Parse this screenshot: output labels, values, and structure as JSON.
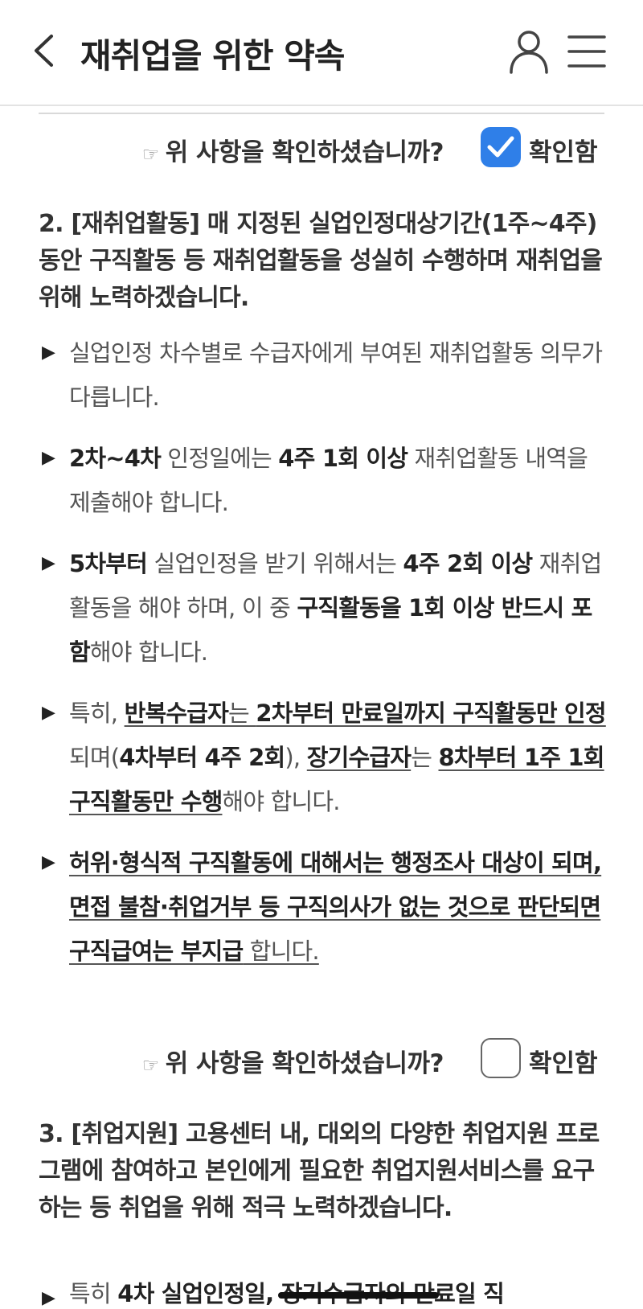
{
  "header": {
    "title": "재취업을 위한 약속",
    "back_icon": "chevron-left-icon",
    "user_icon": "user-icon",
    "menu_icon": "hamburger-menu-icon"
  },
  "confirm_1": {
    "hand_glyph": "☞",
    "question": "위 사항을 확인하셨습니까?",
    "label": "확인함",
    "checked": true
  },
  "section_2": {
    "heading": "2. [재취업활동] 매 지정된 실업인정대상기간(1주~4주) 동안 구직활동 등 재취업활동을 성실히 수행하며 재취업을 위해 노력하겠습니다.",
    "bullets": [
      {
        "p1": "실업인정 차수별로 수급자에게 부여된 재취업활동 의무가 다릅니다."
      },
      {
        "b1": "2차~4차",
        "p1": " 인정일에는 ",
        "b2": "4주 1회 이상",
        "p2": " 재취업활동 내역을 제출해야 합니다."
      },
      {
        "b1": "5차부터",
        "p1": " 실업인정을 받기 위해서는 ",
        "b2": "4주 2회 이상",
        "p2": " 재취업활동을 해야 하며, 이 중 ",
        "b3": "구직활동을 1회 이상 반드시 포함",
        "p3": "해야 합니다."
      },
      {
        "p0": "특히, ",
        "u1": "반복수급자",
        "u2": "는 ",
        "u3": "2차부터 만료일까지 구직활동만 인정",
        "p1": "되며(",
        "b1": "4차부터 4주 2회",
        "p2": "), ",
        "u4": "장기수급자",
        "p3": "는 ",
        "u5": "8차부터 1주 1회 구직활동만 수행",
        "p4": "해야 합니다."
      },
      {
        "u1": "허위·형식적 구직활동에 대해서는 행정조사 대상이 되며, 면접 불참·취업거부 등 구직의사가 없는 것으로 판단되면 구직급여는 부지급",
        "u2": " 합니다."
      }
    ]
  },
  "confirm_2": {
    "hand_glyph": "☞",
    "question": "위 사항을 확인하셨습니까?",
    "label": "확인함",
    "checked": false
  },
  "section_3": {
    "heading": "3. [취업지원] 고용센터 내, 대외의 다양한 취업지원 프로그램에 참여하고 본인에게 필요한 취업지원서비스를 요구하는 등 취업을 위해 적극 노력하겠습니다.",
    "bullet_partial": {
      "p0": "특히 ",
      "b1": "4차 실업인정일, 장기수급자의 만료일 직"
    }
  },
  "arrow_glyph": "▶"
}
